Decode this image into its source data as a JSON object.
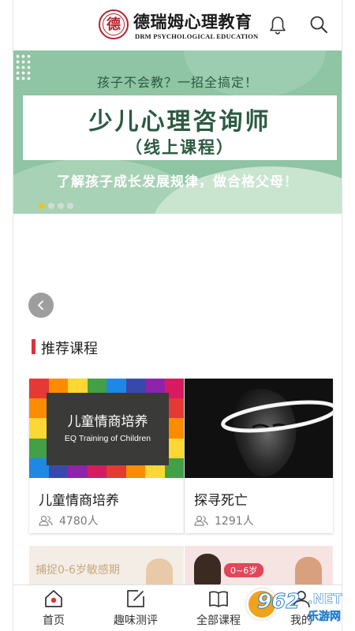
{
  "header": {
    "logo_glyph": "德",
    "brand_cn": "德瑞姆心理教育",
    "brand_en": "DRM PSYCHOLOGICAL EDUCATION",
    "icons": [
      "bell-icon",
      "search-icon"
    ]
  },
  "banner": {
    "top_text": "孩子不会教？一招全搞定！",
    "title": "少儿心理咨询师",
    "subtitle": "（线上课程）",
    "slogan": "了解孩子成长发展规律，做合格父母！",
    "pager": {
      "count": 4,
      "active_index": 0
    },
    "colors": {
      "background": "#8fc4a4",
      "text": "#2c5a42",
      "active_dot": "#e1c632"
    }
  },
  "section": {
    "title": "推荐课程",
    "accent_color": "#d9343c"
  },
  "courses": [
    {
      "title": "儿童情商培养",
      "learners": "4780人",
      "image_text_cn": "儿童情商培养",
      "image_text_en": "EQ Training of Children"
    },
    {
      "title": "探寻死亡",
      "learners": "1291人"
    }
  ],
  "peek_cards": [
    {
      "text": "捕捉0-6岁敏感期"
    },
    {
      "badge": "0~6岁"
    }
  ],
  "bottom_nav": {
    "items": [
      {
        "label": "首页",
        "icon": "home-icon"
      },
      {
        "label": "趣味测评",
        "icon": "edit-icon"
      },
      {
        "label": "全部课程",
        "icon": "book-icon"
      },
      {
        "label": "我的",
        "icon": "user-icon"
      }
    ]
  },
  "watermark": {
    "number": "962",
    "net": ".NET",
    "cn": "乐游网"
  }
}
